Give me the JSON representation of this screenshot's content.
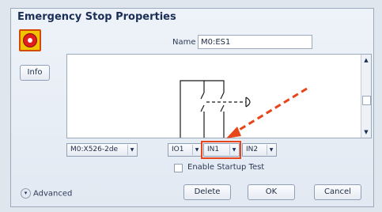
{
  "dialog": {
    "title": "Emergency Stop Properties",
    "info_button": "Info",
    "name_label": "Name",
    "name_value": "M0:ES1",
    "wiring_combo": "M0:X526-2de",
    "io_combo": "IO1",
    "in1_combo": "IN1",
    "in2_combo": "IN2",
    "startup_test_label": "Enable Startup Test",
    "advanced_label": "Advanced",
    "delete_button": "Delete",
    "ok_button": "OK",
    "cancel_button": "Cancel"
  },
  "annotation": {
    "highlight_color": "#e8451a",
    "arrow_color": "#e8451a"
  },
  "icons": {
    "estop": "emergency-stop-icon",
    "combo_drop": "dropdown-arrow-icon",
    "advanced": "expand-chevron-icon"
  }
}
